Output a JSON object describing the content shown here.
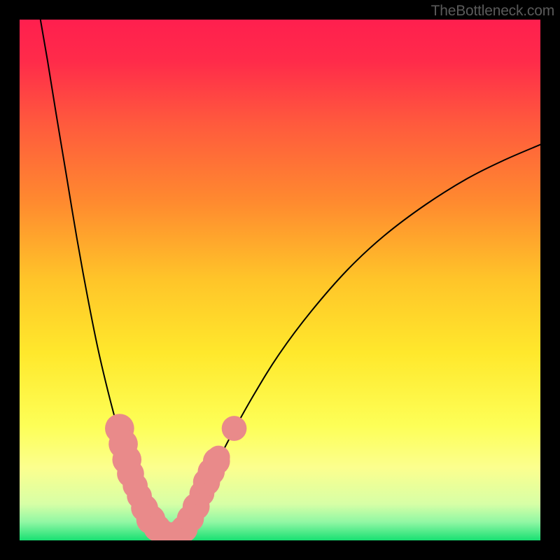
{
  "watermark": "TheBottleneck.com",
  "chart_data": {
    "type": "line",
    "title": "",
    "xlabel": "",
    "ylabel": "",
    "xlim": [
      0,
      100
    ],
    "ylim": [
      0,
      100
    ],
    "gradient_stops": [
      {
        "offset": 0.0,
        "color": "#ff1f4e"
      },
      {
        "offset": 0.08,
        "color": "#ff2b4a"
      },
      {
        "offset": 0.2,
        "color": "#ff5a3d"
      },
      {
        "offset": 0.35,
        "color": "#ff8a2f"
      },
      {
        "offset": 0.5,
        "color": "#ffc529"
      },
      {
        "offset": 0.64,
        "color": "#ffe82c"
      },
      {
        "offset": 0.78,
        "color": "#fdff57"
      },
      {
        "offset": 0.86,
        "color": "#fcff8e"
      },
      {
        "offset": 0.93,
        "color": "#d7ffa6"
      },
      {
        "offset": 0.965,
        "color": "#90f7a4"
      },
      {
        "offset": 1.0,
        "color": "#18e072"
      }
    ],
    "series": [
      {
        "name": "left-branch",
        "type": "line",
        "points": [
          {
            "x": 4.0,
            "y": 100.0
          },
          {
            "x": 5.3,
            "y": 92.5
          },
          {
            "x": 7.0,
            "y": 82.0
          },
          {
            "x": 9.0,
            "y": 70.0
          },
          {
            "x": 11.0,
            "y": 58.0
          },
          {
            "x": 13.0,
            "y": 47.0
          },
          {
            "x": 15.0,
            "y": 37.0
          },
          {
            "x": 17.0,
            "y": 28.5
          },
          {
            "x": 19.0,
            "y": 21.0
          },
          {
            "x": 21.0,
            "y": 14.5
          },
          {
            "x": 23.0,
            "y": 9.0
          },
          {
            "x": 25.5,
            "y": 4.2
          },
          {
            "x": 27.5,
            "y": 1.5
          },
          {
            "x": 29.0,
            "y": 0.6
          }
        ]
      },
      {
        "name": "right-branch",
        "type": "line",
        "points": [
          {
            "x": 29.0,
            "y": 0.6
          },
          {
            "x": 30.5,
            "y": 1.2
          },
          {
            "x": 33.0,
            "y": 5.0
          },
          {
            "x": 36.0,
            "y": 11.0
          },
          {
            "x": 40.0,
            "y": 19.0
          },
          {
            "x": 45.0,
            "y": 28.0
          },
          {
            "x": 50.0,
            "y": 36.0
          },
          {
            "x": 56.0,
            "y": 44.0
          },
          {
            "x": 63.0,
            "y": 52.0
          },
          {
            "x": 70.0,
            "y": 58.5
          },
          {
            "x": 78.0,
            "y": 64.5
          },
          {
            "x": 86.0,
            "y": 69.5
          },
          {
            "x": 93.0,
            "y": 73.0
          },
          {
            "x": 100.0,
            "y": 76.0
          }
        ]
      },
      {
        "name": "overlay-dots-left",
        "type": "scatter",
        "points": [
          {
            "x": 19.2,
            "y": 21.5,
            "r": 2.8
          },
          {
            "x": 19.9,
            "y": 18.5,
            "r": 2.8
          },
          {
            "x": 20.6,
            "y": 15.5,
            "r": 2.8
          },
          {
            "x": 21.3,
            "y": 12.8,
            "r": 2.6
          },
          {
            "x": 22.2,
            "y": 10.5,
            "r": 2.4
          },
          {
            "x": 23.0,
            "y": 8.5,
            "r": 2.4
          },
          {
            "x": 24.0,
            "y": 6.2,
            "r": 2.6
          },
          {
            "x": 25.2,
            "y": 4.0,
            "r": 2.8
          },
          {
            "x": 26.4,
            "y": 2.4,
            "r": 2.6
          },
          {
            "x": 27.6,
            "y": 1.3,
            "r": 2.6
          },
          {
            "x": 28.6,
            "y": 0.8,
            "r": 2.6
          },
          {
            "x": 29.6,
            "y": 0.9,
            "r": 2.6
          },
          {
            "x": 30.6,
            "y": 1.3,
            "r": 2.6
          },
          {
            "x": 31.6,
            "y": 2.2,
            "r": 2.6
          }
        ]
      },
      {
        "name": "overlay-dots-right",
        "type": "scatter",
        "points": [
          {
            "x": 32.8,
            "y": 4.2,
            "r": 2.6
          },
          {
            "x": 33.9,
            "y": 6.5,
            "r": 2.6
          },
          {
            "x": 35.0,
            "y": 9.0,
            "r": 2.4
          },
          {
            "x": 35.9,
            "y": 11.2,
            "r": 2.6
          },
          {
            "x": 36.8,
            "y": 13.2,
            "r": 2.6
          },
          {
            "x": 37.8,
            "y": 15.2,
            "r": 2.6
          },
          {
            "x": 38.2,
            "y": 16.0,
            "r": 2.2
          },
          {
            "x": 41.2,
            "y": 21.5,
            "r": 2.4
          }
        ]
      }
    ],
    "dot_color": "#e98a8a",
    "line_color": "#000000",
    "line_width": 2.0
  }
}
